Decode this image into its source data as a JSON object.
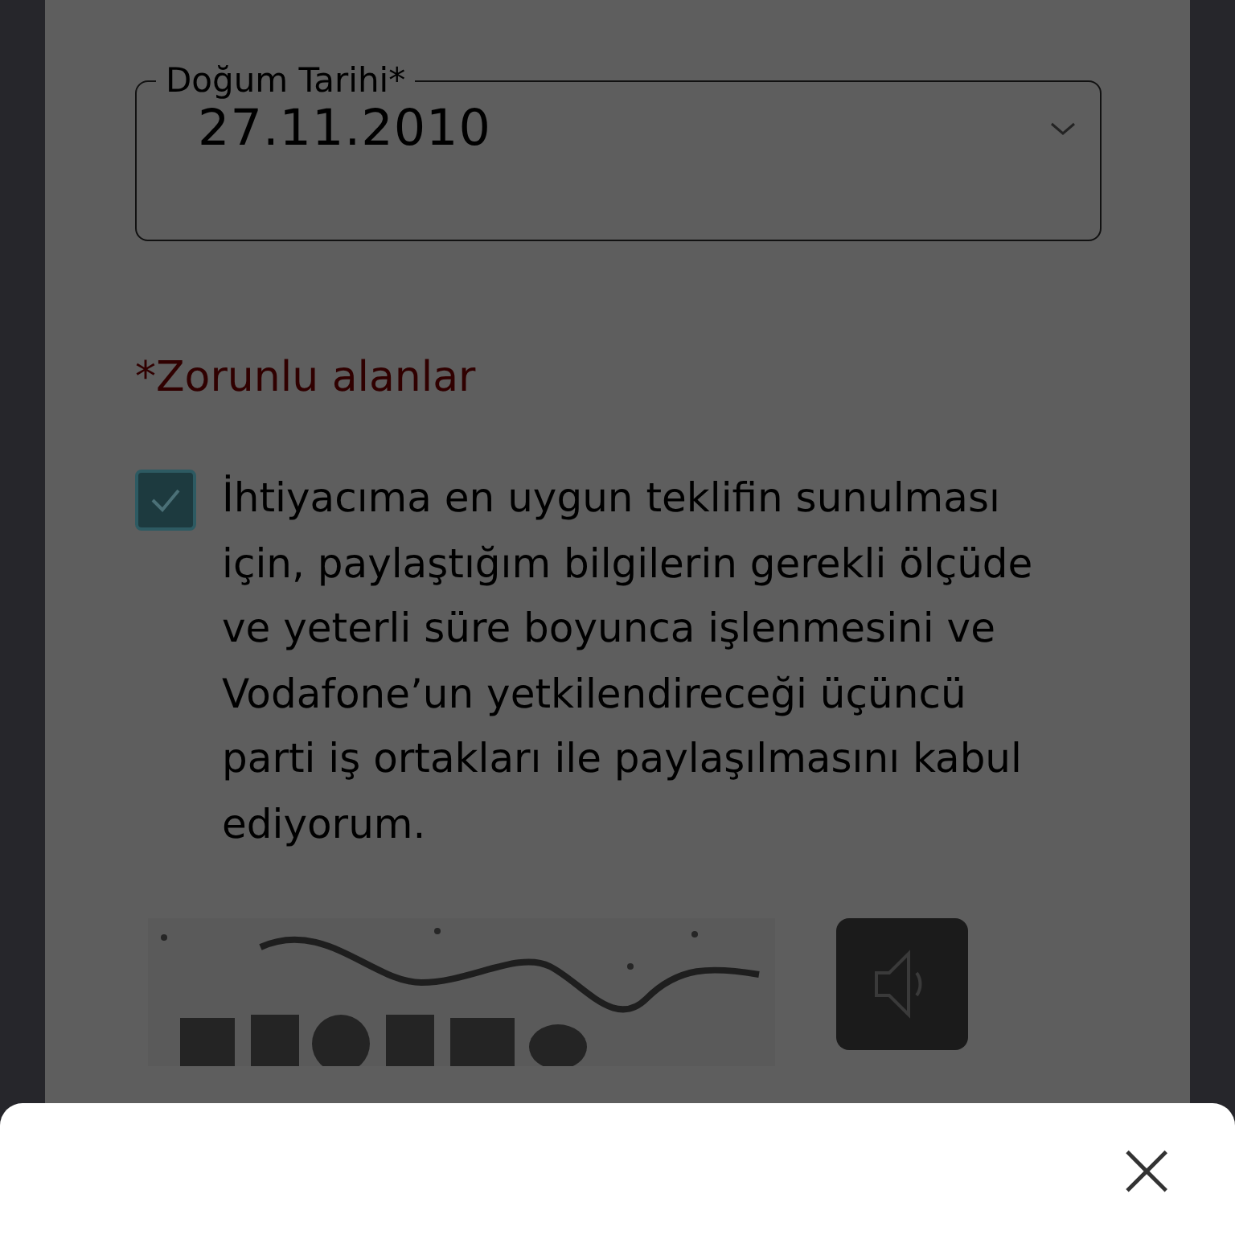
{
  "birth_date": {
    "label": "Doğum Tarihi*",
    "value": "27.11.2010"
  },
  "required_note": "*Zorunlu alanlar",
  "consent": {
    "checked": true,
    "text": "İhtiyacıma en uygun teklifin sunulması için, paylaştığım bilgilerin gerekli ölçüde ve yeterli süre boyunca işlenmesini ve Vodafone’un yetkilendireceği üçüncü parti iş ortakları ile paylaşılmasını kabul ediyorum."
  },
  "bottom_sheet": {
    "close": "×"
  }
}
